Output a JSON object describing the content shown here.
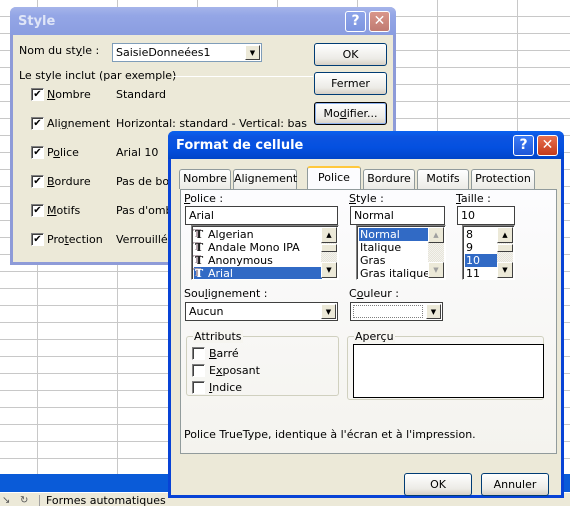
{
  "background": {
    "toolbar_label": "Formes automatiques"
  },
  "style_dialog": {
    "title": "Style",
    "help_icon": "?",
    "close_icon": "✕",
    "style_name_label": "Nom du style :",
    "style_name_value": "SaisieDonneées1",
    "includes_label": "Le style inclut (par exemple)",
    "items": [
      {
        "label": "Nombre",
        "checked": true,
        "value": "Standard"
      },
      {
        "label": "Alignement",
        "checked": true,
        "value": "Horizontal: standard - Vertical: bas"
      },
      {
        "label": "Police",
        "checked": true,
        "value": "Arial 10"
      },
      {
        "label": "Bordure",
        "checked": true,
        "value": "Pas de bordure"
      },
      {
        "label": "Motifs",
        "checked": true,
        "value": "Pas d'ombrage"
      },
      {
        "label": "Protection",
        "checked": true,
        "value": "Verrouillé"
      }
    ],
    "buttons": {
      "ok": "OK",
      "close": "Fermer",
      "modify": "Modifier..."
    }
  },
  "format_dialog": {
    "title": "Format de cellule",
    "help_icon": "?",
    "close_icon": "✕",
    "tabs": [
      "Nombre",
      "Alignement",
      "Police",
      "Bordure",
      "Motifs",
      "Protection"
    ],
    "active_tab": "Police",
    "font": {
      "label": "Police :",
      "value": "Arial",
      "options": [
        "Algerian",
        "Andale Mono IPA",
        "Anonymous",
        "Arial"
      ],
      "selected": "Arial"
    },
    "style": {
      "label": "Style :",
      "value": "Normal",
      "options": [
        "Normal",
        "Italique",
        "Gras",
        "Gras italique"
      ],
      "selected": "Normal"
    },
    "size": {
      "label": "Taille :",
      "value": "10",
      "options": [
        "8",
        "9",
        "10",
        "11"
      ],
      "selected": "10"
    },
    "underline": {
      "label": "Soulignement :",
      "value": "Aucun"
    },
    "color": {
      "label": "Couleur :",
      "value": ""
    },
    "attributes": {
      "label": "Attributs",
      "items": [
        {
          "label": "Barré",
          "checked": false
        },
        {
          "label": "Exposant",
          "checked": false
        },
        {
          "label": "Indice",
          "checked": false
        }
      ]
    },
    "preview_label": "Aperçu",
    "info_text": "Police TrueType, identique à l'écran et à l'impression.",
    "buttons": {
      "ok": "OK",
      "cancel": "Annuler"
    }
  }
}
